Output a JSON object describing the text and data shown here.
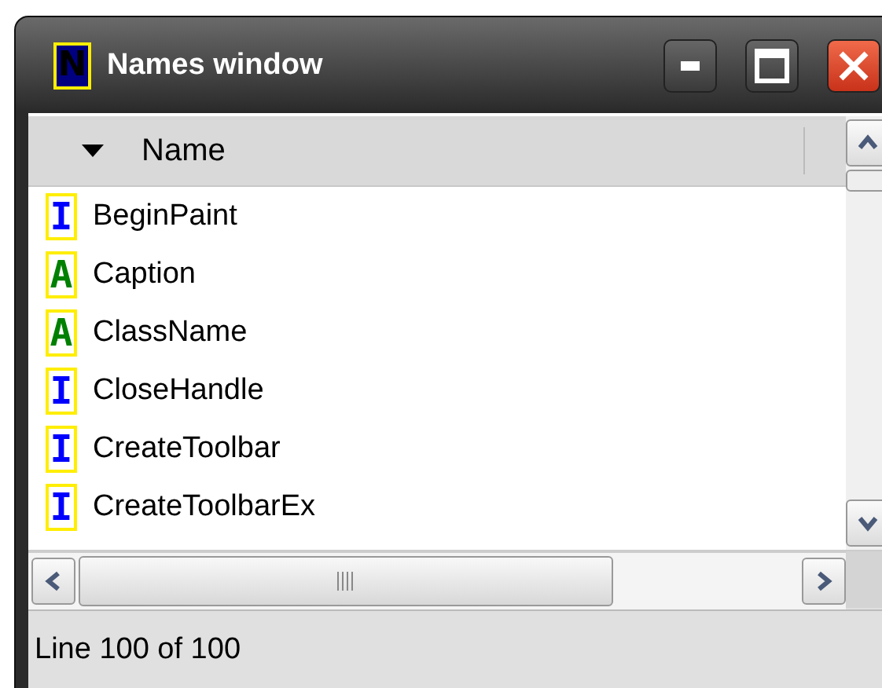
{
  "window": {
    "title": "Names window",
    "icon_letter": "N"
  },
  "list": {
    "column": "Name",
    "sort_descending": true,
    "rows": [
      {
        "badge": "I",
        "kind": "interface",
        "name": "BeginPaint"
      },
      {
        "badge": "A",
        "kind": "attribute",
        "name": "Caption"
      },
      {
        "badge": "A",
        "kind": "attribute",
        "name": "ClassName"
      },
      {
        "badge": "I",
        "kind": "interface",
        "name": "CloseHandle"
      },
      {
        "badge": "I",
        "kind": "interface",
        "name": "CreateToolbar"
      },
      {
        "badge": "I",
        "kind": "interface",
        "name": "CreateToolbarEx"
      }
    ]
  },
  "status_bar": "Line 100 of 100"
}
